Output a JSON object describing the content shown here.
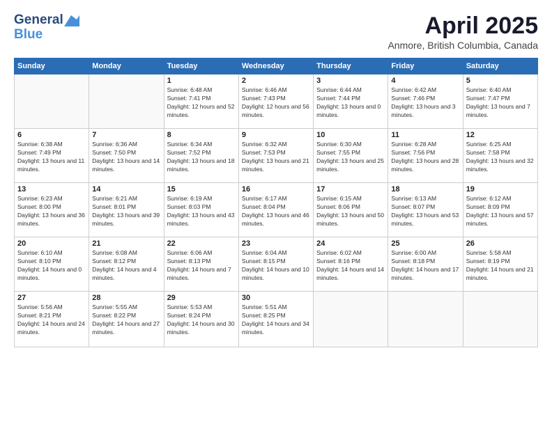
{
  "logo": {
    "line1": "General",
    "line2": "Blue"
  },
  "title": "April 2025",
  "subtitle": "Anmore, British Columbia, Canada",
  "days_of_week": [
    "Sunday",
    "Monday",
    "Tuesday",
    "Wednesday",
    "Thursday",
    "Friday",
    "Saturday"
  ],
  "weeks": [
    [
      {
        "day": "",
        "info": ""
      },
      {
        "day": "",
        "info": ""
      },
      {
        "day": "1",
        "info": "Sunrise: 6:48 AM\nSunset: 7:41 PM\nDaylight: 12 hours and 52 minutes."
      },
      {
        "day": "2",
        "info": "Sunrise: 6:46 AM\nSunset: 7:43 PM\nDaylight: 12 hours and 56 minutes."
      },
      {
        "day": "3",
        "info": "Sunrise: 6:44 AM\nSunset: 7:44 PM\nDaylight: 13 hours and 0 minutes."
      },
      {
        "day": "4",
        "info": "Sunrise: 6:42 AM\nSunset: 7:46 PM\nDaylight: 13 hours and 3 minutes."
      },
      {
        "day": "5",
        "info": "Sunrise: 6:40 AM\nSunset: 7:47 PM\nDaylight: 13 hours and 7 minutes."
      }
    ],
    [
      {
        "day": "6",
        "info": "Sunrise: 6:38 AM\nSunset: 7:49 PM\nDaylight: 13 hours and 11 minutes."
      },
      {
        "day": "7",
        "info": "Sunrise: 6:36 AM\nSunset: 7:50 PM\nDaylight: 13 hours and 14 minutes."
      },
      {
        "day": "8",
        "info": "Sunrise: 6:34 AM\nSunset: 7:52 PM\nDaylight: 13 hours and 18 minutes."
      },
      {
        "day": "9",
        "info": "Sunrise: 6:32 AM\nSunset: 7:53 PM\nDaylight: 13 hours and 21 minutes."
      },
      {
        "day": "10",
        "info": "Sunrise: 6:30 AM\nSunset: 7:55 PM\nDaylight: 13 hours and 25 minutes."
      },
      {
        "day": "11",
        "info": "Sunrise: 6:28 AM\nSunset: 7:56 PM\nDaylight: 13 hours and 28 minutes."
      },
      {
        "day": "12",
        "info": "Sunrise: 6:25 AM\nSunset: 7:58 PM\nDaylight: 13 hours and 32 minutes."
      }
    ],
    [
      {
        "day": "13",
        "info": "Sunrise: 6:23 AM\nSunset: 8:00 PM\nDaylight: 13 hours and 36 minutes."
      },
      {
        "day": "14",
        "info": "Sunrise: 6:21 AM\nSunset: 8:01 PM\nDaylight: 13 hours and 39 minutes."
      },
      {
        "day": "15",
        "info": "Sunrise: 6:19 AM\nSunset: 8:03 PM\nDaylight: 13 hours and 43 minutes."
      },
      {
        "day": "16",
        "info": "Sunrise: 6:17 AM\nSunset: 8:04 PM\nDaylight: 13 hours and 46 minutes."
      },
      {
        "day": "17",
        "info": "Sunrise: 6:15 AM\nSunset: 8:06 PM\nDaylight: 13 hours and 50 minutes."
      },
      {
        "day": "18",
        "info": "Sunrise: 6:13 AM\nSunset: 8:07 PM\nDaylight: 13 hours and 53 minutes."
      },
      {
        "day": "19",
        "info": "Sunrise: 6:12 AM\nSunset: 8:09 PM\nDaylight: 13 hours and 57 minutes."
      }
    ],
    [
      {
        "day": "20",
        "info": "Sunrise: 6:10 AM\nSunset: 8:10 PM\nDaylight: 14 hours and 0 minutes."
      },
      {
        "day": "21",
        "info": "Sunrise: 6:08 AM\nSunset: 8:12 PM\nDaylight: 14 hours and 4 minutes."
      },
      {
        "day": "22",
        "info": "Sunrise: 6:06 AM\nSunset: 8:13 PM\nDaylight: 14 hours and 7 minutes."
      },
      {
        "day": "23",
        "info": "Sunrise: 6:04 AM\nSunset: 8:15 PM\nDaylight: 14 hours and 10 minutes."
      },
      {
        "day": "24",
        "info": "Sunrise: 6:02 AM\nSunset: 8:16 PM\nDaylight: 14 hours and 14 minutes."
      },
      {
        "day": "25",
        "info": "Sunrise: 6:00 AM\nSunset: 8:18 PM\nDaylight: 14 hours and 17 minutes."
      },
      {
        "day": "26",
        "info": "Sunrise: 5:58 AM\nSunset: 8:19 PM\nDaylight: 14 hours and 21 minutes."
      }
    ],
    [
      {
        "day": "27",
        "info": "Sunrise: 5:56 AM\nSunset: 8:21 PM\nDaylight: 14 hours and 24 minutes."
      },
      {
        "day": "28",
        "info": "Sunrise: 5:55 AM\nSunset: 8:22 PM\nDaylight: 14 hours and 27 minutes."
      },
      {
        "day": "29",
        "info": "Sunrise: 5:53 AM\nSunset: 8:24 PM\nDaylight: 14 hours and 30 minutes."
      },
      {
        "day": "30",
        "info": "Sunrise: 5:51 AM\nSunset: 8:25 PM\nDaylight: 14 hours and 34 minutes."
      },
      {
        "day": "",
        "info": ""
      },
      {
        "day": "",
        "info": ""
      },
      {
        "day": "",
        "info": ""
      }
    ]
  ]
}
